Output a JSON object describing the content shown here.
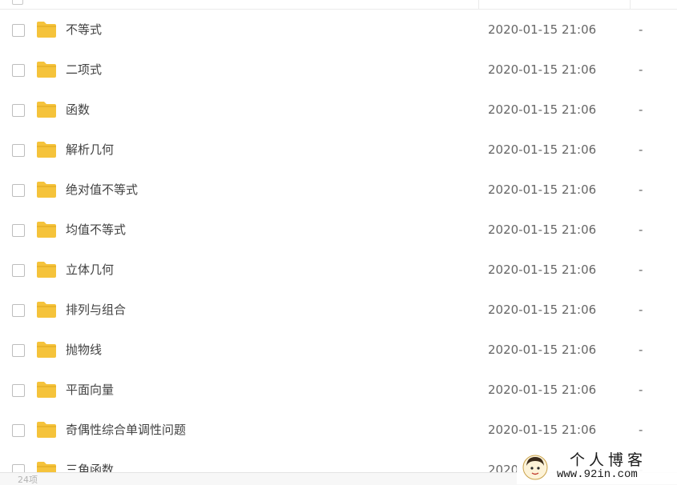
{
  "files": [
    {
      "name": "不等式",
      "modified": "2020-01-15 21:06",
      "size": "-"
    },
    {
      "name": "二项式",
      "modified": "2020-01-15 21:06",
      "size": "-"
    },
    {
      "name": "函数",
      "modified": "2020-01-15 21:06",
      "size": "-"
    },
    {
      "name": "解析几何",
      "modified": "2020-01-15 21:06",
      "size": "-"
    },
    {
      "name": "绝对值不等式",
      "modified": "2020-01-15 21:06",
      "size": "-"
    },
    {
      "name": "均值不等式",
      "modified": "2020-01-15 21:06",
      "size": "-"
    },
    {
      "name": "立体几何",
      "modified": "2020-01-15 21:06",
      "size": "-"
    },
    {
      "name": "排列与组合",
      "modified": "2020-01-15 21:06",
      "size": "-"
    },
    {
      "name": "抛物线",
      "modified": "2020-01-15 21:06",
      "size": "-"
    },
    {
      "name": "平面向量",
      "modified": "2020-01-15 21:06",
      "size": "-"
    },
    {
      "name": "奇偶性综合单调性问题",
      "modified": "2020-01-15 21:06",
      "size": "-"
    },
    {
      "name": "三角函数",
      "modified": "2020",
      "size": "-"
    }
  ],
  "footer": {
    "item_count": "24项"
  },
  "watermark": {
    "title": "个人博客",
    "url": "www.92in.com"
  },
  "colors": {
    "folder": "#f5c33b",
    "folder_tab": "#e9b42c",
    "divider": "#ebebeb"
  },
  "icons": {
    "row_checkbox": "checkbox-icon",
    "row_folder": "folder-icon"
  }
}
